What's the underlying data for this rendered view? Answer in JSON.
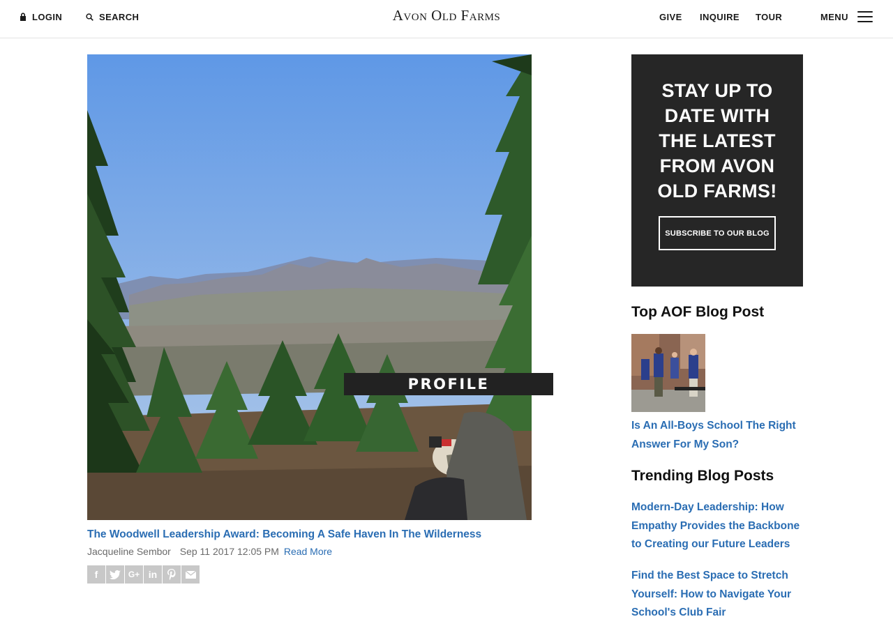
{
  "header": {
    "login": "LOGIN",
    "search": "SEARCH",
    "logo": "Avon Old Farms",
    "give": "GIVE",
    "inquire": "INQUIRE",
    "tour": "TOUR",
    "menu": "MENU"
  },
  "post": {
    "tag": "PROFILE",
    "title": "The Woodwell Leadership Award: Becoming A Safe Haven In The Wilderness",
    "author": "Jacqueline Sembor",
    "date": "Sep 11 2017 12:05 PM",
    "read_more": "Read More",
    "share_icons": [
      "facebook-icon",
      "twitter-icon",
      "google-plus-icon",
      "linkedin-icon",
      "pinterest-icon",
      "email-icon"
    ]
  },
  "sidebar": {
    "cta_heading": "STAY UP TO DATE WITH THE LATEST FROM AVON OLD FARMS!",
    "cta_button": "SUBSCRIBE TO OUR BLOG",
    "top_heading": "Top AOF Blog Post",
    "top_post": "Is An All-Boys School The Right Answer For My Son?",
    "trending_heading": "Trending Blog Posts",
    "trending": [
      "Modern-Day Leadership: How Empathy Provides the Backbone to Creating our Future Leaders",
      "Find the Best Space to Stretch Yourself: How to Navigate Your School's Club Fair"
    ]
  },
  "colors": {
    "link": "#2a6db3",
    "cta_bg": "#262626"
  }
}
